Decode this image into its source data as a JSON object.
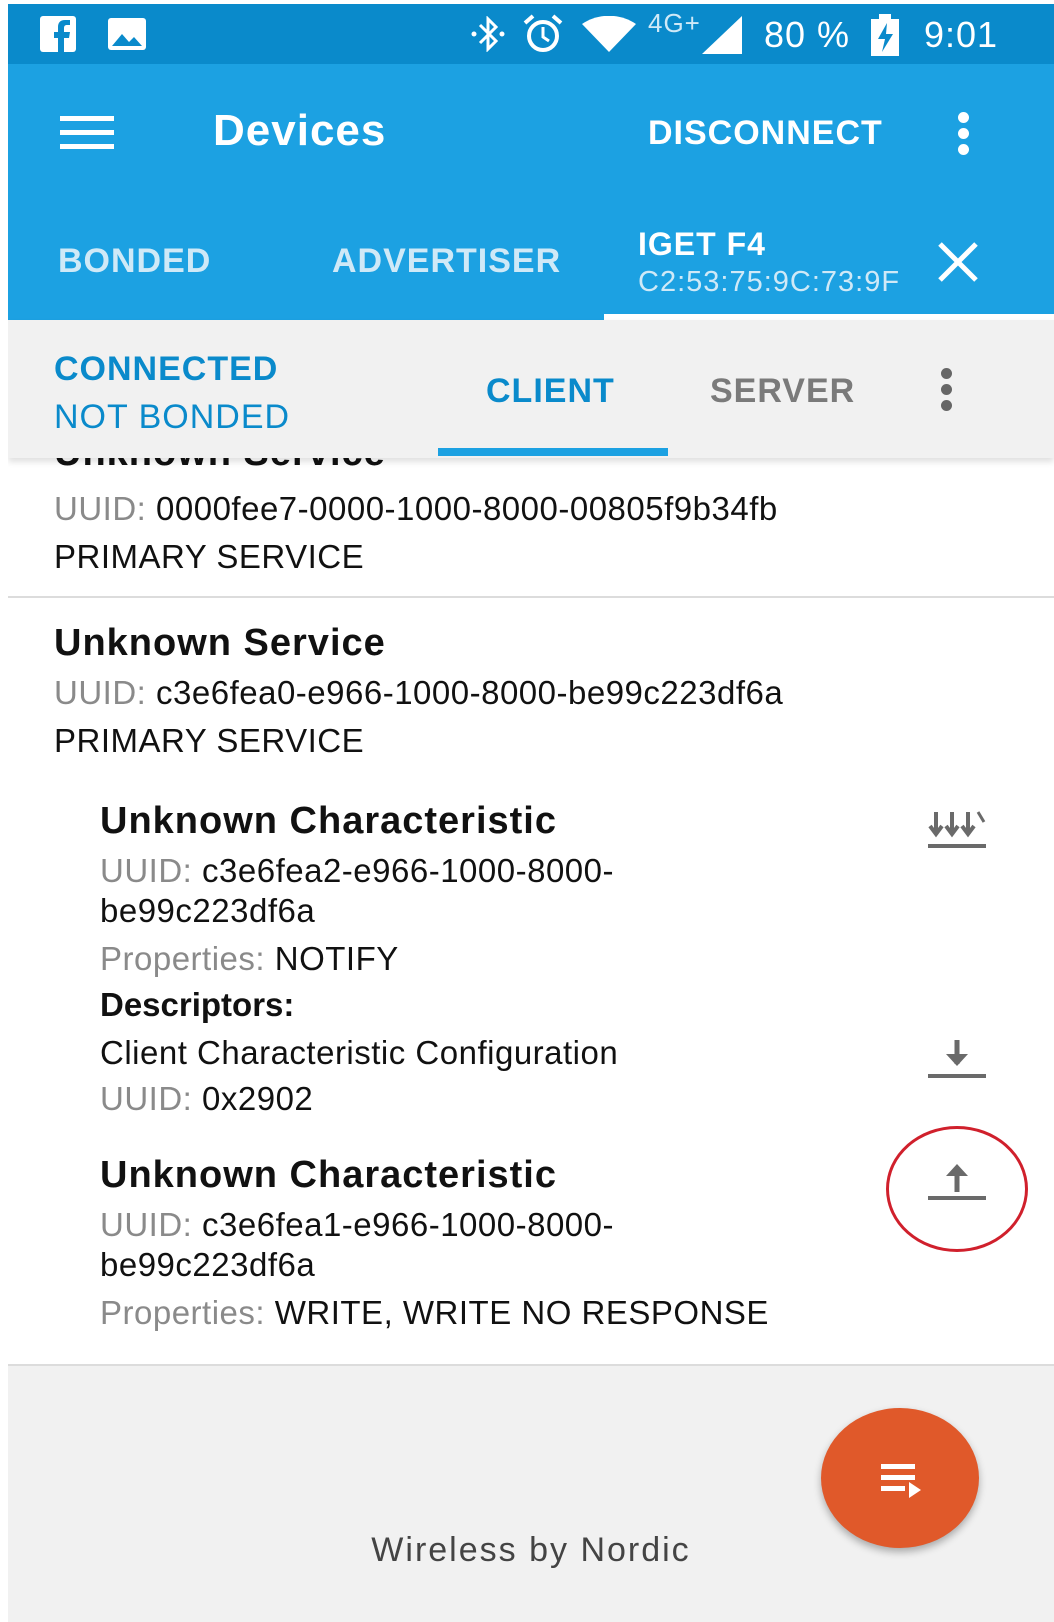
{
  "status_bar": {
    "network": "4G+",
    "battery_percent": "80 %",
    "time": "9:01",
    "left_icons": [
      "facebook-icon",
      "gallery-icon"
    ],
    "right_icons": [
      "bluetooth-icon",
      "alarm-icon",
      "wifi-icon",
      "signal-icon",
      "battery-charging-icon"
    ]
  },
  "app_bar": {
    "title": "Devices",
    "action": "DISCONNECT"
  },
  "tabs": {
    "bonded": "BONDED",
    "advertiser": "ADVERTISER",
    "device": {
      "name": "IGET F4",
      "address": "C2:53:75:9C:73:9F"
    }
  },
  "connection": {
    "state": "CONNECTED",
    "bond_state": "NOT BONDED"
  },
  "sub_tabs": {
    "client": "CLIENT",
    "server": "SERVER",
    "selected": "CLIENT"
  },
  "labels": {
    "uuid": "UUID:",
    "properties": "Properties:",
    "descriptors": "Descriptors:"
  },
  "services": [
    {
      "name": "Unknown Service",
      "uuid": "0000fee7-0000-1000-8000-00805f9b34fb",
      "type": "PRIMARY SERVICE"
    },
    {
      "name": "Unknown Service",
      "uuid": "c3e6fea0-e966-1000-8000-be99c223df6a",
      "type": "PRIMARY SERVICE",
      "characteristics": [
        {
          "name": "Unknown Characteristic",
          "uuid_line1": "c3e6fea2-e966-1000-8000-",
          "uuid_line2": "be99c223df6a",
          "properties": "NOTIFY",
          "action_icon": "notify-download-icon",
          "descriptor": {
            "name": "Client Characteristic Configuration",
            "uuid": "0x2902",
            "action_icon": "download-icon"
          }
        },
        {
          "name": "Unknown Characteristic",
          "uuid_line1": "c3e6fea1-e966-1000-8000-",
          "uuid_line2": "be99c223df6a",
          "properties": "WRITE, WRITE NO RESPONSE",
          "action_icon": "upload-icon"
        }
      ]
    }
  ],
  "footer": {
    "brand": "Wireless by Nordic"
  },
  "colors": {
    "status_bar": "#0a8acb",
    "app_bar": "#1ca1e2",
    "accent": "#0a8acb",
    "fab": "#e0592a",
    "highlight": "#d0202c"
  }
}
